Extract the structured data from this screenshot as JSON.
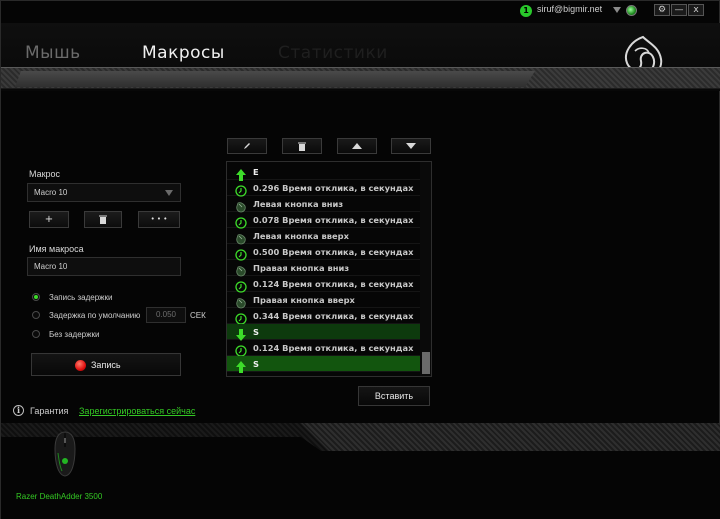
{
  "account": {
    "badge": "1",
    "email": "siruf@bigmir.net"
  },
  "window_controls": {
    "settings": "⚙",
    "minimize": "—",
    "close": "x"
  },
  "nav": {
    "tabs": [
      {
        "label": "Мышь",
        "state": "inactive"
      },
      {
        "label": "Макросы",
        "state": "active"
      },
      {
        "label": "Статистики",
        "state": "faded"
      }
    ]
  },
  "macro_panel": {
    "macro_label": "Макрос",
    "macro_selected": "Macro 10",
    "add_label": "+",
    "delete_icon": "trash-icon",
    "more_label": "• • •",
    "name_label": "Имя макроса",
    "name_value": "Macro 10",
    "delay_options": [
      {
        "label": "Запись задержки",
        "selected": true
      },
      {
        "label": "Задержка по умолчанию",
        "selected": false
      },
      {
        "label": "Без задержки",
        "selected": false
      }
    ],
    "default_delay_value": "0.050",
    "delay_unit": "СЕК",
    "record_label": "Запись"
  },
  "toolbar": {
    "icons": [
      "pencil-icon",
      "trash-icon",
      "arrow-up-icon",
      "arrow-down-icon"
    ]
  },
  "macro_list": [
    {
      "type": "key-up",
      "text": "E"
    },
    {
      "type": "delay",
      "text": "0.296 Время отклика, в секундах"
    },
    {
      "type": "mouse",
      "text": "Левая кнопка вниз"
    },
    {
      "type": "delay",
      "text": "0.078 Время отклика, в секундах"
    },
    {
      "type": "mouse",
      "text": "Левая кнопка вверх"
    },
    {
      "type": "delay",
      "text": "0.500 Время отклика, в секундах"
    },
    {
      "type": "mouse",
      "text": "Правая кнопка вниз"
    },
    {
      "type": "delay",
      "text": "0.124 Время отклика, в секундах"
    },
    {
      "type": "mouse",
      "text": "Правая кнопка вверх"
    },
    {
      "type": "delay",
      "text": "0.344 Время отклика, в секундах"
    },
    {
      "type": "key-down",
      "text": "S",
      "highlight": "dim"
    },
    {
      "type": "delay",
      "text": "0.124 Время отклика, в секундах"
    },
    {
      "type": "key-up",
      "text": "S",
      "highlight": "bright"
    }
  ],
  "list_scroll": {
    "position": "bottom"
  },
  "insert_label": "Вставить",
  "warranty": {
    "label": "Гарантия",
    "link": "Зарегистрироваться сейчас"
  },
  "device": {
    "name": "Razer DeathAdder 3500"
  },
  "colors": {
    "accent": "#34c924",
    "record": "#e01010",
    "selected_row": "#12550e"
  }
}
